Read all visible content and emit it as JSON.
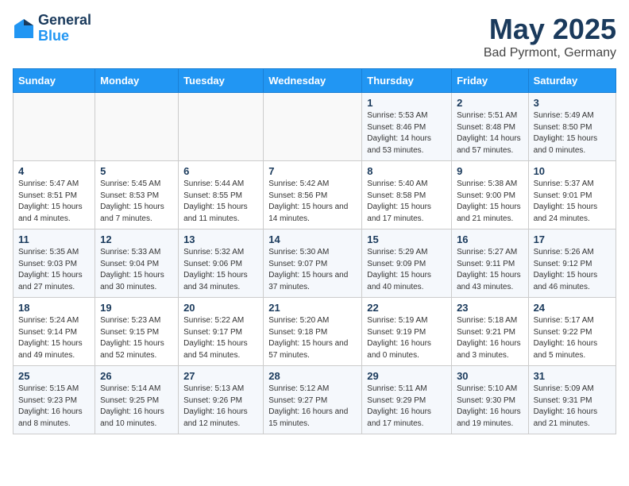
{
  "header": {
    "logo_general": "General",
    "logo_blue": "Blue",
    "title": "May 2025",
    "subtitle": "Bad Pyrmont, Germany"
  },
  "days_of_week": [
    "Sunday",
    "Monday",
    "Tuesday",
    "Wednesday",
    "Thursday",
    "Friday",
    "Saturday"
  ],
  "weeks": [
    [
      {
        "day": "",
        "detail": ""
      },
      {
        "day": "",
        "detail": ""
      },
      {
        "day": "",
        "detail": ""
      },
      {
        "day": "",
        "detail": ""
      },
      {
        "day": "1",
        "detail": "Sunrise: 5:53 AM\nSunset: 8:46 PM\nDaylight: 14 hours\nand 53 minutes."
      },
      {
        "day": "2",
        "detail": "Sunrise: 5:51 AM\nSunset: 8:48 PM\nDaylight: 14 hours\nand 57 minutes."
      },
      {
        "day": "3",
        "detail": "Sunrise: 5:49 AM\nSunset: 8:50 PM\nDaylight: 15 hours\nand 0 minutes."
      }
    ],
    [
      {
        "day": "4",
        "detail": "Sunrise: 5:47 AM\nSunset: 8:51 PM\nDaylight: 15 hours\nand 4 minutes."
      },
      {
        "day": "5",
        "detail": "Sunrise: 5:45 AM\nSunset: 8:53 PM\nDaylight: 15 hours\nand 7 minutes."
      },
      {
        "day": "6",
        "detail": "Sunrise: 5:44 AM\nSunset: 8:55 PM\nDaylight: 15 hours\nand 11 minutes."
      },
      {
        "day": "7",
        "detail": "Sunrise: 5:42 AM\nSunset: 8:56 PM\nDaylight: 15 hours\nand 14 minutes."
      },
      {
        "day": "8",
        "detail": "Sunrise: 5:40 AM\nSunset: 8:58 PM\nDaylight: 15 hours\nand 17 minutes."
      },
      {
        "day": "9",
        "detail": "Sunrise: 5:38 AM\nSunset: 9:00 PM\nDaylight: 15 hours\nand 21 minutes."
      },
      {
        "day": "10",
        "detail": "Sunrise: 5:37 AM\nSunset: 9:01 PM\nDaylight: 15 hours\nand 24 minutes."
      }
    ],
    [
      {
        "day": "11",
        "detail": "Sunrise: 5:35 AM\nSunset: 9:03 PM\nDaylight: 15 hours\nand 27 minutes."
      },
      {
        "day": "12",
        "detail": "Sunrise: 5:33 AM\nSunset: 9:04 PM\nDaylight: 15 hours\nand 30 minutes."
      },
      {
        "day": "13",
        "detail": "Sunrise: 5:32 AM\nSunset: 9:06 PM\nDaylight: 15 hours\nand 34 minutes."
      },
      {
        "day": "14",
        "detail": "Sunrise: 5:30 AM\nSunset: 9:07 PM\nDaylight: 15 hours\nand 37 minutes."
      },
      {
        "day": "15",
        "detail": "Sunrise: 5:29 AM\nSunset: 9:09 PM\nDaylight: 15 hours\nand 40 minutes."
      },
      {
        "day": "16",
        "detail": "Sunrise: 5:27 AM\nSunset: 9:11 PM\nDaylight: 15 hours\nand 43 minutes."
      },
      {
        "day": "17",
        "detail": "Sunrise: 5:26 AM\nSunset: 9:12 PM\nDaylight: 15 hours\nand 46 minutes."
      }
    ],
    [
      {
        "day": "18",
        "detail": "Sunrise: 5:24 AM\nSunset: 9:14 PM\nDaylight: 15 hours\nand 49 minutes."
      },
      {
        "day": "19",
        "detail": "Sunrise: 5:23 AM\nSunset: 9:15 PM\nDaylight: 15 hours\nand 52 minutes."
      },
      {
        "day": "20",
        "detail": "Sunrise: 5:22 AM\nSunset: 9:17 PM\nDaylight: 15 hours\nand 54 minutes."
      },
      {
        "day": "21",
        "detail": "Sunrise: 5:20 AM\nSunset: 9:18 PM\nDaylight: 15 hours\nand 57 minutes."
      },
      {
        "day": "22",
        "detail": "Sunrise: 5:19 AM\nSunset: 9:19 PM\nDaylight: 16 hours\nand 0 minutes."
      },
      {
        "day": "23",
        "detail": "Sunrise: 5:18 AM\nSunset: 9:21 PM\nDaylight: 16 hours\nand 3 minutes."
      },
      {
        "day": "24",
        "detail": "Sunrise: 5:17 AM\nSunset: 9:22 PM\nDaylight: 16 hours\nand 5 minutes."
      }
    ],
    [
      {
        "day": "25",
        "detail": "Sunrise: 5:15 AM\nSunset: 9:23 PM\nDaylight: 16 hours\nand 8 minutes."
      },
      {
        "day": "26",
        "detail": "Sunrise: 5:14 AM\nSunset: 9:25 PM\nDaylight: 16 hours\nand 10 minutes."
      },
      {
        "day": "27",
        "detail": "Sunrise: 5:13 AM\nSunset: 9:26 PM\nDaylight: 16 hours\nand 12 minutes."
      },
      {
        "day": "28",
        "detail": "Sunrise: 5:12 AM\nSunset: 9:27 PM\nDaylight: 16 hours\nand 15 minutes."
      },
      {
        "day": "29",
        "detail": "Sunrise: 5:11 AM\nSunset: 9:29 PM\nDaylight: 16 hours\nand 17 minutes."
      },
      {
        "day": "30",
        "detail": "Sunrise: 5:10 AM\nSunset: 9:30 PM\nDaylight: 16 hours\nand 19 minutes."
      },
      {
        "day": "31",
        "detail": "Sunrise: 5:09 AM\nSunset: 9:31 PM\nDaylight: 16 hours\nand 21 minutes."
      }
    ]
  ]
}
